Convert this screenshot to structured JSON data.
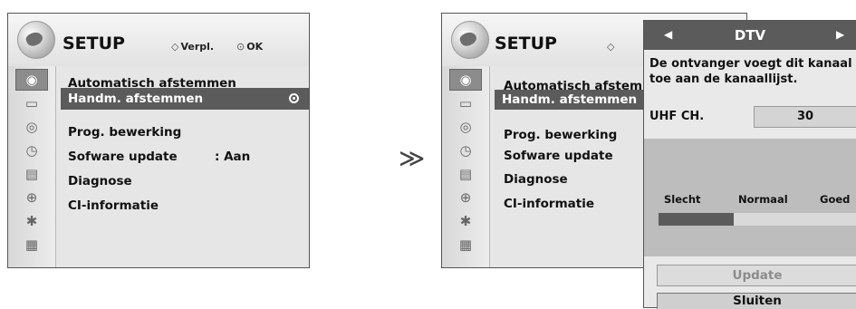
{
  "menu": {
    "title": "SETUP",
    "hint_move": "Verpl.",
    "hint_ok": "OK",
    "items": [
      {
        "label": "Automatisch afstemmen"
      },
      {
        "label": "Handm. afstemmen"
      },
      {
        "label": "Prog. bewerking"
      },
      {
        "label": "Sofware update",
        "value": ": Aan"
      },
      {
        "label": "Diagnose"
      },
      {
        "label": "CI-informatie"
      }
    ],
    "truncated_first": "Automatisch afstemme",
    "icons": [
      "setup-icon",
      "picture-icon",
      "audio-icon",
      "time-icon",
      "option-icon",
      "lock-icon",
      "input-icon",
      "usb-icon"
    ]
  },
  "popup": {
    "title": "DTV",
    "message": "De ontvanger voegt dit kanaal toe aan de kanaallijst.",
    "channel_label": "UHF CH.",
    "channel_value": "30",
    "signal_low": "Slecht",
    "signal_mid": "Normaal",
    "signal_high": "Goed",
    "signal_level": 0.38,
    "update_label": "Update",
    "close_label": "Sluiten"
  },
  "arrow": "≫"
}
